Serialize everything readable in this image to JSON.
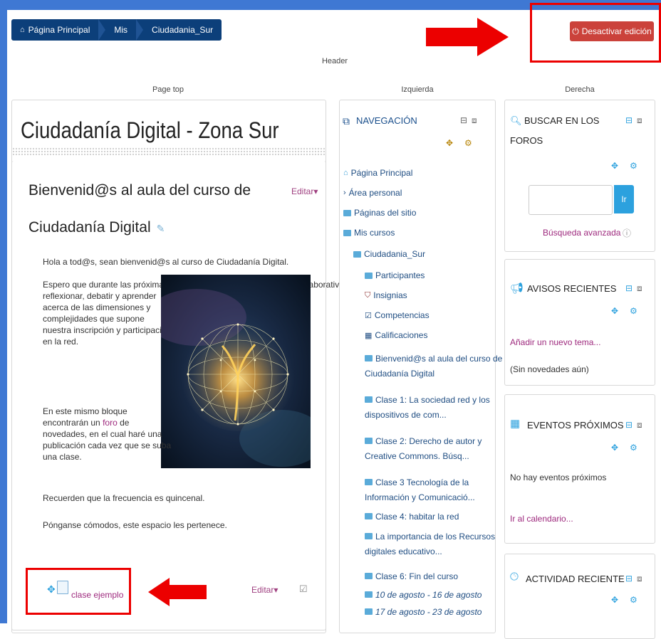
{
  "breadcrumb": [
    "Página Principal",
    "Mis",
    "Ciudadania_Sur"
  ],
  "header": {
    "edit_button": "Desactivar edición",
    "header_label": "Header"
  },
  "regions": {
    "page_top": "Page top",
    "left": "Izquierda",
    "right": "Derecha"
  },
  "course": {
    "title": "Ciudadanía Digital - Zona Sur"
  },
  "welcome": {
    "heading_line1": "Bienvenid@s al aula del curso de",
    "heading_line2": "Ciudadanía Digital",
    "edit_menu": "Editar",
    "p1": "Hola a tod@s, sean bienvenid@s al curso de Ciudadanía Digital.",
    "p2_line1": "Espero que durante las próximas seis clases podamos, de manera colaborativa,",
    "p2_lines": [
      "reflexionar, debatir y aprender",
      "acerca de las dimensiones y",
      "complejidades que supone",
      "nuestra inscripción y participación",
      "en la red."
    ],
    "p3_before": "En este mismo bloque",
    "p3_mid_before": "encontrarán un ",
    "p3_link": "foro",
    "p3_mid_after": " de",
    "p3_lines": [
      "novedades, en el cual haré una",
      "publicación cada vez que se suba",
      "una clase."
    ],
    "p4": "Recuerden que la frecuencia es quincenal.",
    "p5": "Pónganse cómodos, este espacio les pertenece."
  },
  "resource": {
    "label": "clase ejemplo",
    "edit_menu": "Editar"
  },
  "navigation": {
    "title": "NAVEGACIÓN",
    "items": [
      "Página Principal",
      "Área personal",
      "Páginas del sitio",
      "Mis cursos",
      "Ciudadania_Sur",
      "Participantes",
      "Insignias",
      "Competencias",
      "Calificaciones"
    ],
    "sections": [
      [
        "Bienvenid@s al aula del curso de",
        "Ciudadanía Digital"
      ],
      [
        "Clase 1: La sociedad red y los",
        "dispositivos de com..."
      ],
      [
        "Clase 2: Derecho de autor y",
        "Creative Commons. Búsq..."
      ],
      [
        "Clase 3 Tecnología de la",
        "Información y Comunicació..."
      ],
      [
        "Clase 4: habitar la red"
      ],
      [
        "La importancia de los Recursos",
        "digitales educativo..."
      ],
      [
        "Clase 6: Fin del curso"
      ]
    ],
    "weeks": [
      "10 de agosto - 16 de agosto",
      "17 de agosto - 23 de agosto"
    ]
  },
  "forum_search": {
    "title_line1": "BUSCAR EN LOS",
    "title_line2": "FOROS",
    "go": "Ir",
    "advanced": "Búsqueda avanzada"
  },
  "news": {
    "title": "AVISOS RECIENTES",
    "add": "Añadir un nuevo tema...",
    "none": "(Sin novedades aún)"
  },
  "events": {
    "title": "EVENTOS PRÓXIMOS",
    "none": "No hay eventos próximos",
    "calendar": "Ir al calendario..."
  },
  "activity": {
    "title": "ACTIVIDAD RECIENTE"
  },
  "colors": {
    "frame": "#3f78d3",
    "breadcrumb": "#0c3f7a",
    "danger": "#cb423b",
    "annotation": "#ec0000",
    "accent": "#2ca1de",
    "link": "#9e2a7e"
  }
}
